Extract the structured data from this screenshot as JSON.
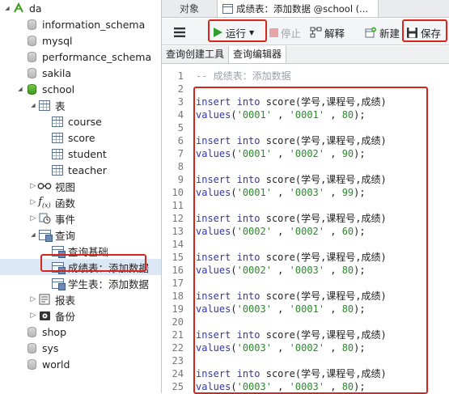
{
  "sidebar": {
    "items": [
      {
        "label": "da",
        "icon": "connection-icon",
        "level": 0,
        "arrow": "down"
      },
      {
        "label": "information_schema",
        "icon": "database-gray-icon",
        "level": 1,
        "arrow": ""
      },
      {
        "label": "mysql",
        "icon": "database-gray-icon",
        "level": 1,
        "arrow": ""
      },
      {
        "label": "performance_schema",
        "icon": "database-gray-icon",
        "level": 1,
        "arrow": ""
      },
      {
        "label": "sakila",
        "icon": "database-gray-icon",
        "level": 1,
        "arrow": ""
      },
      {
        "label": "school",
        "icon": "database-green-icon",
        "level": 1,
        "arrow": "down"
      },
      {
        "label": "表",
        "icon": "table-group-icon",
        "level": 2,
        "arrow": "down"
      },
      {
        "label": "course",
        "icon": "table-icon",
        "level": 3,
        "arrow": ""
      },
      {
        "label": "score",
        "icon": "table-icon",
        "level": 3,
        "arrow": ""
      },
      {
        "label": "student",
        "icon": "table-icon",
        "level": 3,
        "arrow": ""
      },
      {
        "label": "teacher",
        "icon": "table-icon",
        "level": 3,
        "arrow": ""
      },
      {
        "label": "视图",
        "icon": "view-icon",
        "level": 2,
        "arrow": "right"
      },
      {
        "label": "函数",
        "icon": "function-icon",
        "level": 2,
        "arrow": "right"
      },
      {
        "label": "事件",
        "icon": "event-icon",
        "level": 2,
        "arrow": "right"
      },
      {
        "label": "查询",
        "icon": "query-group-icon",
        "level": 2,
        "arrow": "down"
      },
      {
        "label": "查询基础",
        "icon": "query-icon",
        "level": 3,
        "arrow": ""
      },
      {
        "label": "成绩表：添加数据",
        "icon": "query-icon",
        "level": 3,
        "arrow": ""
      },
      {
        "label": "学生表：添加数据",
        "icon": "query-icon",
        "level": 3,
        "arrow": ""
      },
      {
        "label": "报表",
        "icon": "report-icon",
        "level": 2,
        "arrow": "right"
      },
      {
        "label": "备份",
        "icon": "backup-icon",
        "level": 2,
        "arrow": "right"
      },
      {
        "label": "shop",
        "icon": "database-gray-icon",
        "level": 1,
        "arrow": ""
      },
      {
        "label": "sys",
        "icon": "database-gray-icon",
        "level": 1,
        "arrow": ""
      },
      {
        "label": "world",
        "icon": "database-gray-icon",
        "level": 1,
        "arrow": ""
      }
    ]
  },
  "tabs": {
    "objects": "对象",
    "document": "成绩表：添加数据 @school (..."
  },
  "toolbar": {
    "menu_icon": "hamburger-icon",
    "run": "运行",
    "stop": "停止",
    "explain": "解释",
    "new": "新建",
    "save": "保存"
  },
  "subtabs": {
    "builder": "查询创建工具",
    "editor": "查询编辑器"
  },
  "editor": {
    "lines": [
      {
        "n": "1",
        "parts": [
          [
            "cm",
            "-- 成绩表：添加数据"
          ]
        ]
      },
      {
        "n": "2",
        "parts": []
      },
      {
        "n": "3",
        "parts": [
          [
            "kw",
            "insert"
          ],
          [
            "p",
            " "
          ],
          [
            "kw",
            "into"
          ],
          [
            "p",
            " score(学号,课程号,成绩)"
          ]
        ]
      },
      {
        "n": "4",
        "parts": [
          [
            "fn",
            "values"
          ],
          [
            "p",
            "("
          ],
          [
            "str",
            "'0001'"
          ],
          [
            "p",
            " , "
          ],
          [
            "str",
            "'0001'"
          ],
          [
            "p",
            " , "
          ],
          [
            "num",
            "80"
          ],
          [
            "p",
            ");"
          ]
        ]
      },
      {
        "n": "5",
        "parts": []
      },
      {
        "n": "6",
        "parts": [
          [
            "kw",
            "insert"
          ],
          [
            "p",
            " "
          ],
          [
            "kw",
            "into"
          ],
          [
            "p",
            " score(学号,课程号,成绩)"
          ]
        ]
      },
      {
        "n": "7",
        "parts": [
          [
            "fn",
            "values"
          ],
          [
            "p",
            "("
          ],
          [
            "str",
            "'0001'"
          ],
          [
            "p",
            " , "
          ],
          [
            "str",
            "'0002'"
          ],
          [
            "p",
            " , "
          ],
          [
            "num",
            "90"
          ],
          [
            "p",
            ");"
          ]
        ]
      },
      {
        "n": "8",
        "parts": []
      },
      {
        "n": "9",
        "parts": [
          [
            "kw",
            "insert"
          ],
          [
            "p",
            " "
          ],
          [
            "kw",
            "into"
          ],
          [
            "p",
            " score(学号,课程号,成绩)"
          ]
        ]
      },
      {
        "n": "10",
        "parts": [
          [
            "fn",
            "values"
          ],
          [
            "p",
            "("
          ],
          [
            "str",
            "'0001'"
          ],
          [
            "p",
            " , "
          ],
          [
            "str",
            "'0003'"
          ],
          [
            "p",
            " , "
          ],
          [
            "num",
            "99"
          ],
          [
            "p",
            ");"
          ]
        ]
      },
      {
        "n": "11",
        "parts": []
      },
      {
        "n": "12",
        "parts": [
          [
            "kw",
            "insert"
          ],
          [
            "p",
            " "
          ],
          [
            "kw",
            "into"
          ],
          [
            "p",
            " score(学号,课程号,成绩)"
          ]
        ]
      },
      {
        "n": "13",
        "parts": [
          [
            "fn",
            "values"
          ],
          [
            "p",
            "("
          ],
          [
            "str",
            "'0002'"
          ],
          [
            "p",
            " , "
          ],
          [
            "str",
            "'0002'"
          ],
          [
            "p",
            " , "
          ],
          [
            "num",
            "60"
          ],
          [
            "p",
            ");"
          ]
        ]
      },
      {
        "n": "14",
        "parts": []
      },
      {
        "n": "15",
        "parts": [
          [
            "kw",
            "insert"
          ],
          [
            "p",
            " "
          ],
          [
            "kw",
            "into"
          ],
          [
            "p",
            " score(学号,课程号,成绩)"
          ]
        ]
      },
      {
        "n": "16",
        "parts": [
          [
            "fn",
            "values"
          ],
          [
            "p",
            "("
          ],
          [
            "str",
            "'0002'"
          ],
          [
            "p",
            " , "
          ],
          [
            "str",
            "'0003'"
          ],
          [
            "p",
            " , "
          ],
          [
            "num",
            "80"
          ],
          [
            "p",
            ");"
          ]
        ]
      },
      {
        "n": "17",
        "parts": []
      },
      {
        "n": "18",
        "parts": [
          [
            "kw",
            "insert"
          ],
          [
            "p",
            " "
          ],
          [
            "kw",
            "into"
          ],
          [
            "p",
            " score(学号,课程号,成绩)"
          ]
        ]
      },
      {
        "n": "19",
        "parts": [
          [
            "fn",
            "values"
          ],
          [
            "p",
            "("
          ],
          [
            "str",
            "'0003'"
          ],
          [
            "p",
            " , "
          ],
          [
            "str",
            "'0001'"
          ],
          [
            "p",
            " , "
          ],
          [
            "num",
            "80"
          ],
          [
            "p",
            ");"
          ]
        ]
      },
      {
        "n": "20",
        "parts": []
      },
      {
        "n": "21",
        "parts": [
          [
            "kw",
            "insert"
          ],
          [
            "p",
            " "
          ],
          [
            "kw",
            "into"
          ],
          [
            "p",
            " score(学号,课程号,成绩)"
          ]
        ]
      },
      {
        "n": "22",
        "parts": [
          [
            "fn",
            "values"
          ],
          [
            "p",
            "("
          ],
          [
            "str",
            "'0003'"
          ],
          [
            "p",
            " , "
          ],
          [
            "str",
            "'0002'"
          ],
          [
            "p",
            " , "
          ],
          [
            "num",
            "80"
          ],
          [
            "p",
            ");"
          ]
        ]
      },
      {
        "n": "23",
        "parts": []
      },
      {
        "n": "24",
        "parts": [
          [
            "kw",
            "insert"
          ],
          [
            "p",
            " "
          ],
          [
            "kw",
            "into"
          ],
          [
            "p",
            " score(学号,课程号,成绩)"
          ]
        ]
      },
      {
        "n": "25",
        "parts": [
          [
            "fn",
            "values"
          ],
          [
            "p",
            "("
          ],
          [
            "str",
            "'0003'"
          ],
          [
            "p",
            " , "
          ],
          [
            "str",
            "'0003'"
          ],
          [
            "p",
            " , "
          ],
          [
            "num",
            "80"
          ],
          [
            "p",
            ");"
          ]
        ]
      }
    ]
  },
  "colors": {
    "highlight": "#d9261c",
    "run_green": "#2fa02f",
    "keyword": "#2d38a8",
    "string": "#2a8a2a"
  }
}
